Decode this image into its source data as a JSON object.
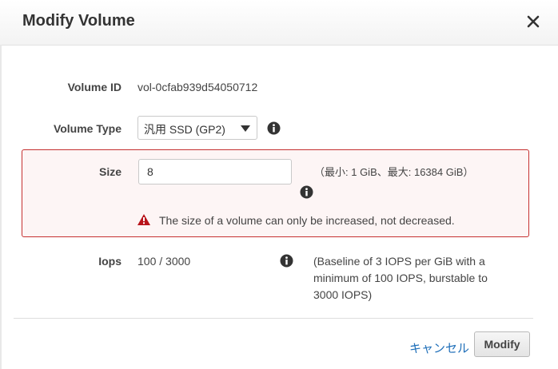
{
  "dialog": {
    "title": "Modify Volume",
    "close_icon": "close-icon"
  },
  "fields": {
    "volume_id": {
      "label": "Volume ID",
      "value": "vol-0cfab939d54050712"
    },
    "volume_type": {
      "label": "Volume Type",
      "selected": "汎用 SSD (GP2)",
      "icon": "info-icon"
    },
    "size": {
      "label": "Size",
      "value": "8",
      "hint": "（最小: 1 GiB、最大: 16384 GiB）",
      "icon": "info-icon",
      "error_icon": "warning-icon",
      "error": "The size of a volume can only be increased, not decreased."
    },
    "iops": {
      "label": "Iops",
      "value": "100 / 3000",
      "icon": "info-icon",
      "description": "(Baseline of 3 IOPS per GiB with a minimum of 100 IOPS, burstable to 3000 IOPS)"
    }
  },
  "footer": {
    "cancel_label": "キャンセル",
    "modify_label": "Modify"
  },
  "colors": {
    "error_border": "#c53030",
    "error_background": "#fdf5f5",
    "link": "#1f6fb9",
    "warning": "#b8141b"
  }
}
